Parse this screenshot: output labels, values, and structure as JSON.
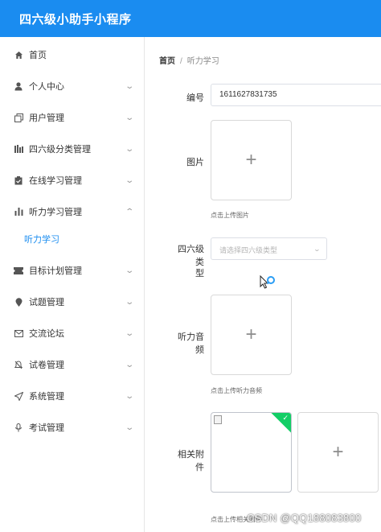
{
  "app": {
    "title": "四六级小助手小程序"
  },
  "sidebar": {
    "items": [
      {
        "label": "首页",
        "icon": "home-icon",
        "has_chevron": false
      },
      {
        "label": "个人中心",
        "icon": "user-icon",
        "has_chevron": true
      },
      {
        "label": "用户管理",
        "icon": "copy-icon",
        "has_chevron": true
      },
      {
        "label": "四六级分类管理",
        "icon": "bars-icon",
        "has_chevron": true
      },
      {
        "label": "在线学习管理",
        "icon": "clipboard-icon",
        "has_chevron": true
      },
      {
        "label": "听力学习管理",
        "icon": "chart-icon",
        "has_chevron": true,
        "expanded": true
      },
      {
        "label": "听力学习",
        "sub": true,
        "active": true
      },
      {
        "label": "目标计划管理",
        "icon": "ticket-icon",
        "has_chevron": true
      },
      {
        "label": "试题管理",
        "icon": "location-icon",
        "has_chevron": true
      },
      {
        "label": "交流论坛",
        "icon": "message-icon",
        "has_chevron": true
      },
      {
        "label": "试卷管理",
        "icon": "bell-icon",
        "has_chevron": true
      },
      {
        "label": "系统管理",
        "icon": "send-icon",
        "has_chevron": true
      },
      {
        "label": "考试管理",
        "icon": "microphone-icon",
        "has_chevron": true
      }
    ]
  },
  "breadcrumb": {
    "home": "首页",
    "separator": "/",
    "current": "听力学习"
  },
  "form": {
    "number": {
      "label": "编号",
      "value": "1611627831735"
    },
    "image": {
      "label": "图片",
      "hint": "点击上传图片"
    },
    "category": {
      "label_line1": "四六级类",
      "label_line2": "型",
      "placeholder": "请选择四六级类型"
    },
    "audio": {
      "label": "听力音频",
      "hint": "点击上传听力音频"
    },
    "attachment": {
      "label": "相关附件",
      "hint": "点击上传相关附件"
    }
  },
  "colors": {
    "brand": "#1a8cf0",
    "success": "#13ce66"
  },
  "watermark": "CSDN @QQ188083800"
}
